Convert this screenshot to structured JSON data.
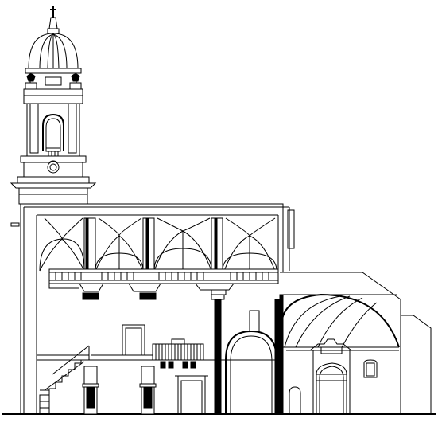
{
  "drawing": {
    "type": "architectural-section",
    "stroke_color": "#000000",
    "background_color": "#ffffff",
    "parts": [
      "bell-tower",
      "dome",
      "cross",
      "nave",
      "rib-vaults",
      "choir-gallery",
      "balustrade",
      "staircase",
      "arches",
      "portal",
      "side-chapel",
      "annex"
    ]
  }
}
